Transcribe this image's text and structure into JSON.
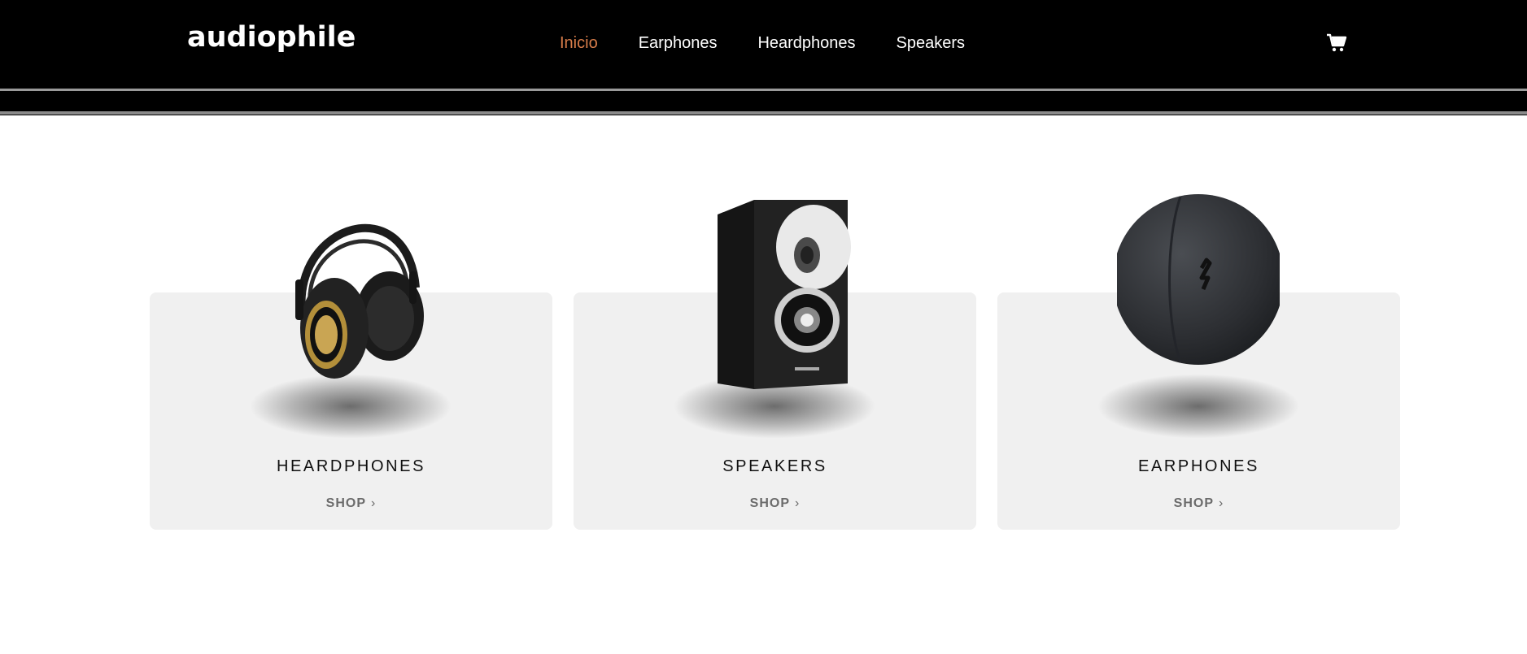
{
  "header": {
    "logo": "audiophile",
    "nav": [
      {
        "label": "Inicio",
        "active": true
      },
      {
        "label": "Earphones",
        "active": false
      },
      {
        "label": "Heardphones",
        "active": false
      },
      {
        "label": "Speakers",
        "active": false
      }
    ],
    "cart_icon": "cart-icon"
  },
  "categories": [
    {
      "title": "HEARDPHONES",
      "shop_label": "SHOP",
      "chevron": "›",
      "icon": "headphones-image"
    },
    {
      "title": "SPEAKERS",
      "shop_label": "SHOP",
      "chevron": "›",
      "icon": "speaker-image"
    },
    {
      "title": "EARPHONES",
      "shop_label": "SHOP",
      "chevron": "›",
      "icon": "earphones-case-image"
    }
  ],
  "colors": {
    "accent": "#d87d4a",
    "header_bg": "#000000",
    "card_bg": "#f0f0f0"
  }
}
